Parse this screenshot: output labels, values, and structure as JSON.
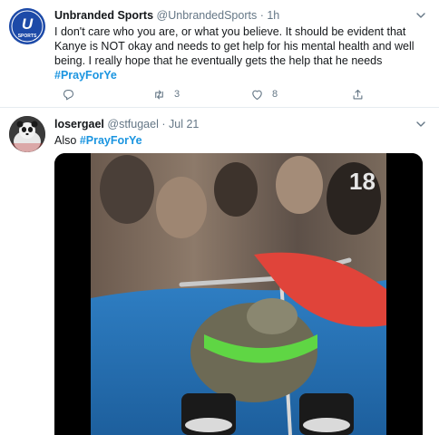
{
  "tweets": [
    {
      "display_name": "Unbranded Sports",
      "handle": "@UnbrandedSports",
      "separator": "·",
      "time": "1h",
      "text": "I don't care who you are, or what you believe. It should be evident that Kanye is NOT okay and needs to get help for his mental health and well being. I really hope that he eventually gets the help that he needs",
      "hashtag": "#PrayForYe",
      "avatar_letter": "U",
      "avatar_sub": "SPORTS",
      "retweets": "3",
      "likes": "8"
    },
    {
      "display_name": "losergael",
      "handle": "@stfugael",
      "separator": "·",
      "time": "Jul 21",
      "text_prefix": "Also",
      "hashtag": "#PrayForYe",
      "media_jersey_number": "18"
    }
  ],
  "icons": {
    "caret": "chevron-down-icon",
    "reply": "reply-icon",
    "retweet": "retweet-icon",
    "like": "heart-icon",
    "share": "share-icon"
  },
  "colors": {
    "link": "#1b95e0",
    "secondary_text": "#657786",
    "divider": "#e6ecf0",
    "avatar_brand": "#1d4aa8"
  }
}
